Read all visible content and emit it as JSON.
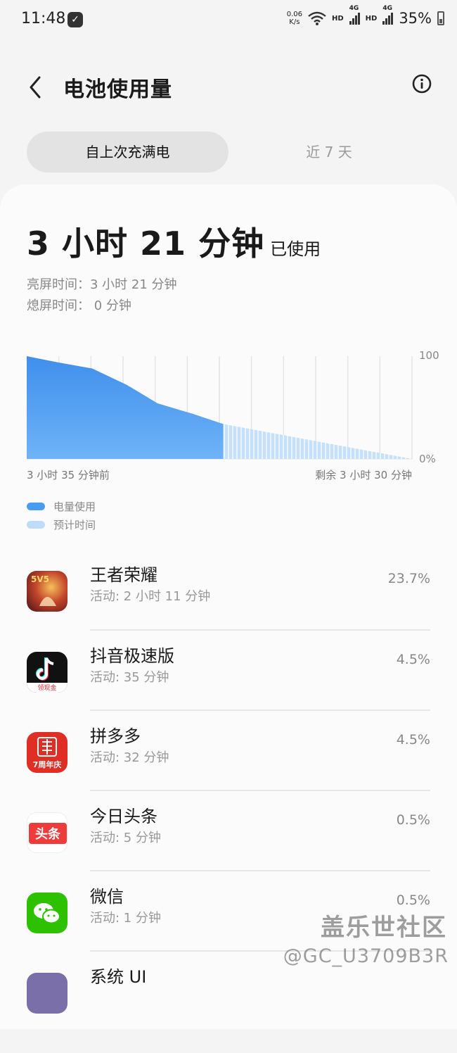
{
  "status_bar": {
    "time": "11:48",
    "speed_value": "0.06",
    "speed_unit": "K/s",
    "hd1": "HD",
    "net1": "4G",
    "hd2": "HD",
    "net2": "4G",
    "battery": "35%"
  },
  "header": {
    "title": "电池使用量"
  },
  "tabs": [
    {
      "label": "自上次充满电",
      "active": true
    },
    {
      "label": "近 7 天",
      "active": false
    }
  ],
  "summary": {
    "used_big": "3 小时 21 分钟",
    "used_suffix": "已使用",
    "screen_on": "亮屏时间：3 小时 21 分钟",
    "screen_off": "熄屏时间： 0 分钟"
  },
  "chart_data": {
    "type": "area",
    "x_start_label": "3 小时 35 分钟前",
    "x_end_label": "剩余 3 小时 30 分钟",
    "y_top_label": "100",
    "y_bottom_label": "0%",
    "ylim": [
      0,
      100
    ],
    "series": [
      {
        "name": "电量使用",
        "x": [
          0,
          0.08,
          0.17,
          0.26,
          0.34,
          0.43,
          0.51
        ],
        "values": [
          100,
          94,
          88,
          72,
          54,
          44,
          34
        ]
      },
      {
        "name": "预计时间",
        "x": [
          0.51,
          1.0
        ],
        "values": [
          34,
          0
        ]
      }
    ],
    "legend": [
      "电量使用",
      "预计时间"
    ],
    "colors": {
      "used": "#4a9cf0",
      "estimate": "#bcdcf8"
    }
  },
  "apps": [
    {
      "name": "王者荣耀",
      "activity": "活动: 2 小时 11 分钟",
      "percent": "23.7%",
      "icon": "honor-of-kings-icon"
    },
    {
      "name": "抖音极速版",
      "activity": "活动: 35 分钟",
      "percent": "4.5%",
      "icon": "douyin-lite-icon"
    },
    {
      "name": "拼多多",
      "activity": "活动: 32 分钟",
      "percent": "4.5%",
      "icon": "pinduoduo-icon",
      "icon_text": "7周年庆"
    },
    {
      "name": "今日头条",
      "activity": "活动: 5 分钟",
      "percent": "0.5%",
      "icon": "toutiao-icon",
      "icon_text": "头条"
    },
    {
      "name": "微信",
      "activity": "活动: 1 分钟",
      "percent": "0.5%",
      "icon": "wechat-icon"
    },
    {
      "name": "系统 UI",
      "activity": "",
      "percent": "",
      "icon": "system-ui-icon"
    }
  ],
  "douyin_badge": "领现金",
  "watermark": {
    "line1": "盖乐世社区",
    "line2": "@GC_U3709B3R"
  }
}
